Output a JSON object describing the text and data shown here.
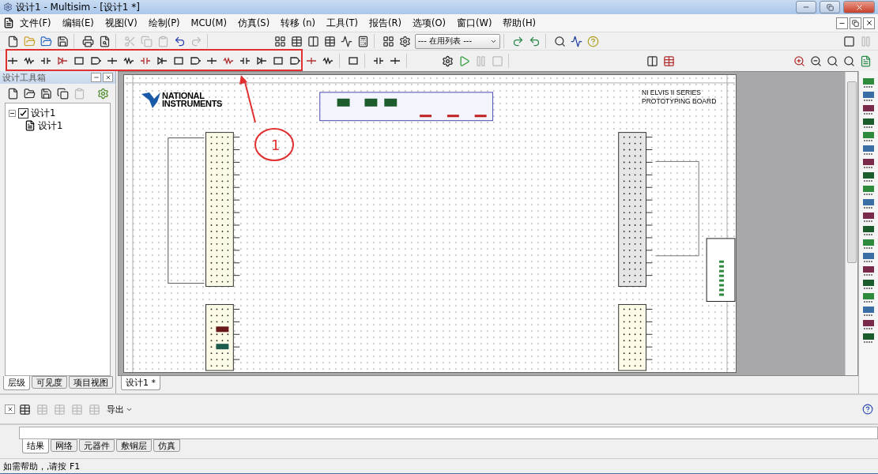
{
  "window": {
    "title": "设计1 - Multisim - [设计1 *]"
  },
  "menu": [
    "文件(F)",
    "编辑(E)",
    "视图(V)",
    "绘制(P)",
    "MCU(M)",
    "仿真(S)",
    "转移 (n)",
    "工具(T)",
    "报告(R)",
    "选项(O)",
    "窗口(W)",
    "帮助(H)"
  ],
  "toolbar": {
    "list_dropdown": "--- 在用列表 ---"
  },
  "design_toolbox": {
    "title": "设计工具箱",
    "tree": [
      {
        "label": "设计1",
        "checked": true,
        "expanded": true,
        "children": [
          {
            "label": "设计1"
          }
        ]
      }
    ],
    "tabs": [
      {
        "label": "层级",
        "selected": true
      },
      {
        "label": "可见度",
        "selected": false
      },
      {
        "label": "项目视图",
        "selected": false
      }
    ]
  },
  "canvas": {
    "logo": [
      "NATIONAL",
      "INSTRUMENTS"
    ],
    "board_title": [
      "NI ELVIS II SERIES",
      "PROTOTYPING BOARD"
    ],
    "tabs": [
      {
        "label": "设计1 *",
        "selected": true
      }
    ]
  },
  "annotation": {
    "label": "1"
  },
  "spreadsheet": {
    "export_button": "导出",
    "tabs": [
      {
        "label": "结果",
        "selected": true
      },
      {
        "label": "网络",
        "selected": false
      },
      {
        "label": "元器件",
        "selected": false
      },
      {
        "label": "敷铜层",
        "selected": false
      },
      {
        "label": "仿真",
        "selected": false
      }
    ]
  },
  "status_bar": "如需帮助，,请按 F1"
}
